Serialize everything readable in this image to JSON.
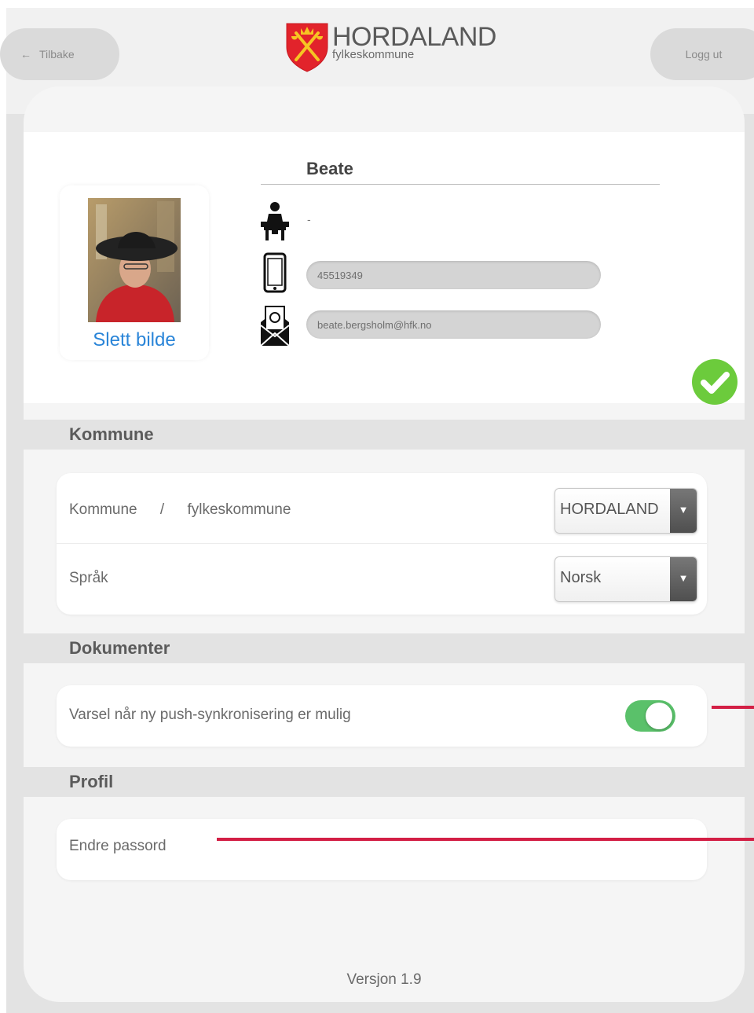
{
  "header": {
    "back_label": "Tilbake",
    "logout_label": "Logg ut",
    "logo_title": "HORDALAND",
    "logo_subtitle": "fylkeskommune"
  },
  "profile": {
    "name": "Beate",
    "role_value": "-",
    "phone": "45519349",
    "email": "beate.bergsholm@hfk.no",
    "delete_photo_label": "Slett bilde"
  },
  "sections": {
    "kommune": {
      "title": "Kommune",
      "kommune_label_part1": "Kommune",
      "kommune_label_sep": "/",
      "kommune_label_part2": "fylkeskommune",
      "kommune_value": "HORDALAND",
      "sprak_label": "Språk",
      "sprak_value": "Norsk"
    },
    "dokumenter": {
      "title": "Dokumenter",
      "push_label": "Varsel når ny push-synkronisering er mulig",
      "push_enabled": true
    },
    "profil": {
      "title": "Profil",
      "password_label": "Endre passord"
    }
  },
  "footer": {
    "version": "Versjon 1.9"
  },
  "colors": {
    "link_blue": "#2a85d8",
    "toggle_green": "#5ac16a",
    "annotation_red": "#d31f45",
    "save_green": "#6ccb3c",
    "logo_red": "#e2232b"
  }
}
